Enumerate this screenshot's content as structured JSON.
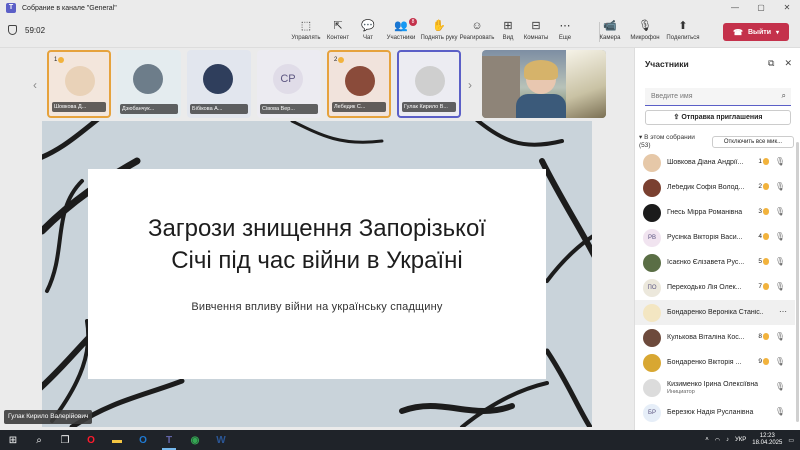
{
  "window": {
    "title": "Собрание в канале \"General\"",
    "controls": [
      "—",
      "▢",
      "✕"
    ]
  },
  "meeting": {
    "timer": "59:02"
  },
  "toolbar": {
    "tools": [
      {
        "label": "Управлять",
        "icon": "manage-icon",
        "glyph": "⬚"
      },
      {
        "label": "Контент",
        "icon": "share-content-icon",
        "glyph": "⇱"
      },
      {
        "label": "Чат",
        "icon": "chat-icon",
        "glyph": "💬"
      },
      {
        "label": "Участники",
        "icon": "participants-icon",
        "glyph": "👥",
        "badge": "8"
      },
      {
        "label": "Поднять руку",
        "icon": "raise-hand-icon",
        "glyph": "✋"
      },
      {
        "label": "Реагировать",
        "icon": "react-icon",
        "glyph": "☺"
      },
      {
        "label": "Вид",
        "icon": "view-icon",
        "glyph": "⊞"
      },
      {
        "label": "Комнаты",
        "icon": "rooms-icon",
        "glyph": "⊟"
      },
      {
        "label": "Еще",
        "icon": "more-icon",
        "glyph": "⋯"
      },
      {
        "label": "Камера",
        "icon": "camera-icon",
        "glyph": "📹"
      },
      {
        "label": "Микрофон",
        "icon": "microphone-icon",
        "glyph": "🎙"
      },
      {
        "label": "Поделиться",
        "icon": "share-icon",
        "glyph": "⬆"
      }
    ],
    "leave_label": "Выйти"
  },
  "strip": {
    "tiles": [
      {
        "name": "Шовкова Д...",
        "num": "1",
        "style": "active",
        "face": "#e9d2b8",
        "bg": "#f3e6dc"
      },
      {
        "name": "Дзюбанчук...",
        "style": "",
        "face": "#6d7d8a",
        "bg": "#e4ecef"
      },
      {
        "name": "Бібікова А...",
        "style": "",
        "face": "#2f3e5c",
        "bg": "#e2e6ee"
      },
      {
        "name": "Сівова Вер...",
        "style": "",
        "initials": "СР",
        "bg": "#ecebf1"
      },
      {
        "name": "Лебедик С...",
        "num": "2",
        "style": "active",
        "face": "#8a4b3a",
        "bg": "#f1e3dc"
      },
      {
        "name": "Гулак Кирило В...",
        "style": "selected",
        "face": "#cfcfcf",
        "bg": "#ececf2"
      }
    ]
  },
  "slide": {
    "title_line1": "Загрози знищення Запорізької",
    "title_line2": "Січі під час війни в Україні",
    "subtitle": "Вивчення впливу війни на українську спадщину"
  },
  "presenter": {
    "name": "Гулак Кирило Валерійович"
  },
  "panel": {
    "title": "Участники",
    "search_placeholder": "Введите имя",
    "invite_label": "Отправка приглашения",
    "section_label": "В этом собрании",
    "section_count": "(53)",
    "mute_all_label": "Отключить все мик...",
    "participants": [
      {
        "name": "Шовкова Діана Андрії...",
        "num": "1",
        "avatar_color": "#e6c8a8",
        "initials": ""
      },
      {
        "name": "Лебедик Софія Волод...",
        "num": "2",
        "avatar_color": "#7a4030",
        "initials": ""
      },
      {
        "name": "Гнесь Мірра Романівна",
        "num": "3",
        "avatar_color": "#1b1b1b",
        "initials": ""
      },
      {
        "name": "Русінка Вікторія Васи...",
        "num": "4",
        "avatar_color": "#f1e4f0",
        "initials": "РВ"
      },
      {
        "name": "Ісаєнко Єлізавета Рус...",
        "num": "5",
        "avatar_color": "#5a6e45",
        "initials": ""
      },
      {
        "name": "Переходько Лія Олек...",
        "num": "7",
        "avatar_color": "#ece8dc",
        "initials": "ПО"
      },
      {
        "name": "Бондаренко Вероніка Станіс...",
        "num": "",
        "avatar_color": "#f3e6c2",
        "initials": "",
        "highlight": true
      },
      {
        "name": "Кулькова Віталіна Кос...",
        "num": "8",
        "avatar_color": "#6d4a3c",
        "initials": ""
      },
      {
        "name": "Бондаренко Вікторія ...",
        "num": "9",
        "avatar_color": "#d8a732",
        "initials": ""
      },
      {
        "name": "Кизименко Ірина Олексіївна",
        "role": "Инициатор",
        "num": "",
        "avatar_color": "#dcdcdc",
        "initials": ""
      },
      {
        "name": "Березюк Надія Русланівна",
        "num": "",
        "avatar_color": "#e6eef8",
        "initials": "БР"
      }
    ]
  },
  "taskbar": {
    "items": [
      {
        "icon": "windows-start-icon",
        "glyph": "⊞"
      },
      {
        "icon": "search-icon",
        "glyph": "⌕"
      },
      {
        "icon": "task-view-icon",
        "glyph": "❐"
      },
      {
        "icon": "opera-icon",
        "glyph": "O"
      },
      {
        "icon": "file-explorer-icon",
        "glyph": "▬"
      },
      {
        "icon": "outlook-icon",
        "glyph": "O"
      },
      {
        "icon": "teams-icon",
        "glyph": "T",
        "active": true
      },
      {
        "icon": "chrome-icon",
        "glyph": "◉"
      },
      {
        "icon": "word-icon",
        "glyph": "W"
      }
    ],
    "lang": "УКР",
    "time": "12:23",
    "date": "18.04.2025"
  },
  "colors": {
    "accent": "#5b5fc7",
    "leave": "#c4314b",
    "active_speaker": "#e6a23c"
  }
}
